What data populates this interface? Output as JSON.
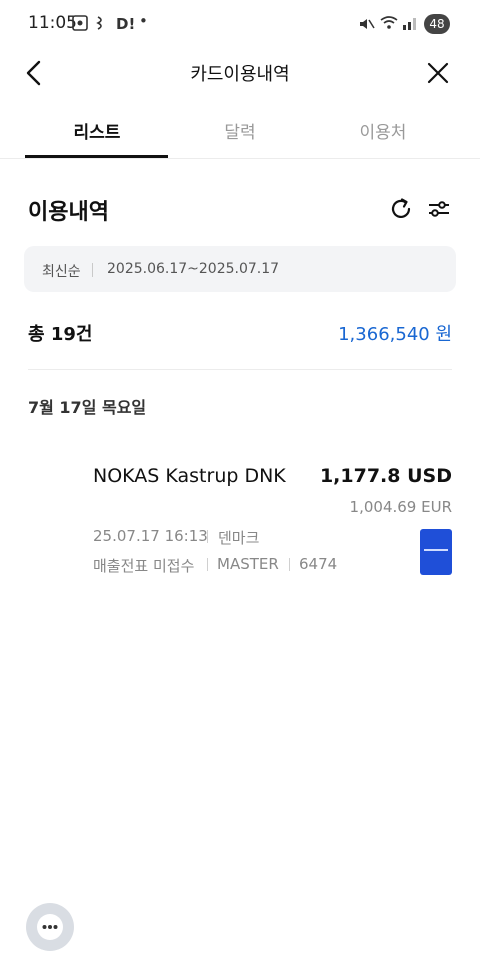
{
  "status_bar": {
    "time": "11:05",
    "notification_text": "D!",
    "battery": "48"
  },
  "header": {
    "title": "카드이용내역"
  },
  "tabs": [
    {
      "label": "리스트",
      "active": true
    },
    {
      "label": "달력",
      "active": false
    },
    {
      "label": "이용처",
      "active": false
    }
  ],
  "section": {
    "title": "이용내역",
    "sort": "최신순",
    "date_range": "2025.06.17~2025.07.17",
    "total_label": "총 19건",
    "total_amount": "1,366,540 원"
  },
  "date_group": "7월 17일 목요일",
  "transaction": {
    "merchant": "NOKAS Kastrup DNK",
    "amount": "1,177.8 USD",
    "sub_amount": "1,004.69 EUR",
    "datetime": "25.07.17 16:13",
    "country": "덴마크",
    "receipt_status": "매출전표 미접수",
    "card_brand": "MASTER",
    "card_last4": "6474"
  },
  "colors": {
    "accent": "#1967d2",
    "card": "#1f4fd8"
  }
}
